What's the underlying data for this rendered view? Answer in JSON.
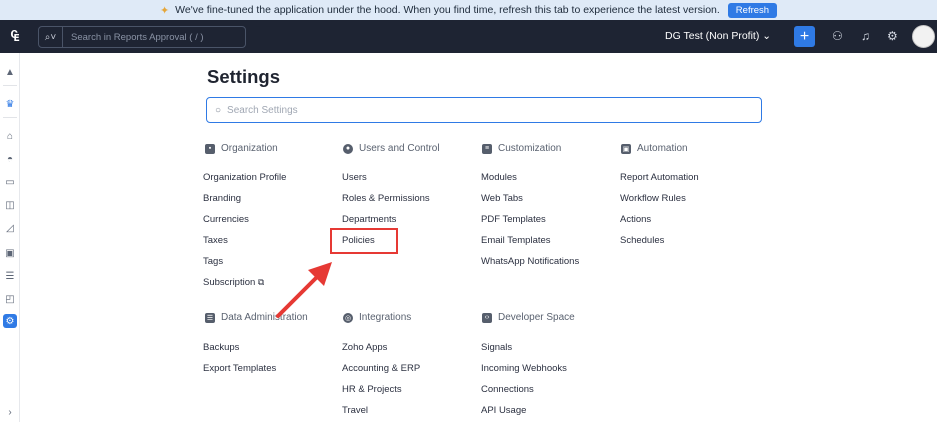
{
  "banner": {
    "message": "We've fine-tuned the application under the hood. When you find time, refresh this tab to experience the latest version.",
    "refresh_label": "Refresh"
  },
  "topnav": {
    "search_placeholder": "Search in Reports Approval ( / )",
    "org_name": "DG Test (Non Profit) ⌄"
  },
  "page": {
    "title": "Settings",
    "search_placeholder": "Search Settings"
  },
  "sections": {
    "organization": {
      "title": "Organization",
      "items": [
        "Organization Profile",
        "Branding",
        "Currencies",
        "Taxes",
        "Tags",
        "Subscription"
      ]
    },
    "users_control": {
      "title": "Users and Control",
      "items": [
        "Users",
        "Roles & Permissions",
        "Departments",
        "Policies"
      ]
    },
    "customization": {
      "title": "Customization",
      "items": [
        "Modules",
        "Web Tabs",
        "PDF Templates",
        "Email Templates",
        "WhatsApp Notifications"
      ]
    },
    "automation": {
      "title": "Automation",
      "items": [
        "Report Automation",
        "Workflow Rules",
        "Actions",
        "Schedules"
      ]
    },
    "data_admin": {
      "title": "Data Administration",
      "items": [
        "Backups",
        "Export Templates"
      ]
    },
    "integrations": {
      "title": "Integrations",
      "items": [
        "Zoho Apps",
        "Accounting & ERP",
        "HR & Projects",
        "Travel"
      ]
    },
    "developer": {
      "title": "Developer Space",
      "items": [
        "Signals",
        "Incoming Webhooks",
        "Connections",
        "API Usage"
      ]
    }
  },
  "colors": {
    "accent": "#2f7ae5",
    "nav_bg": "#1e2433",
    "highlight": "#e63934"
  }
}
